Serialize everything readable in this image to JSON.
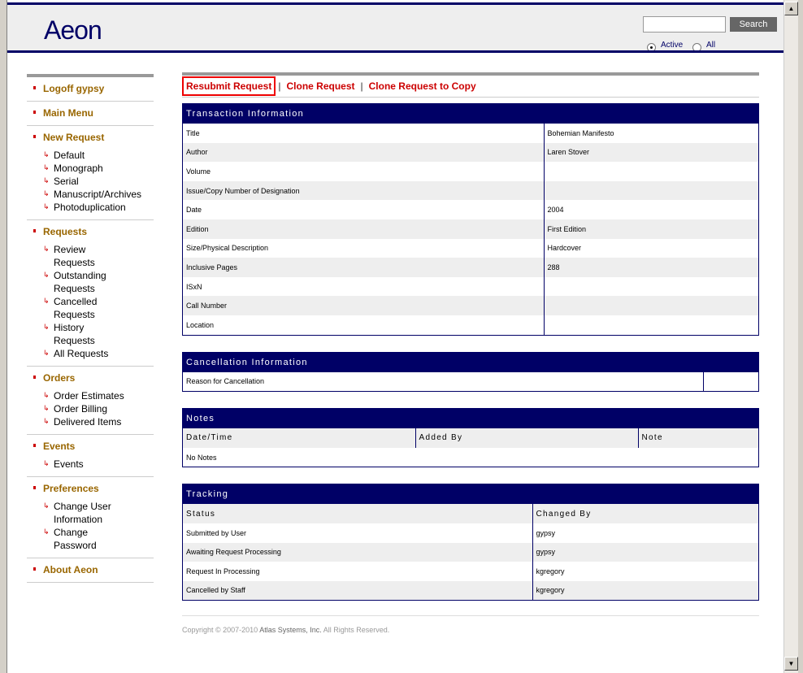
{
  "header": {
    "logo": "Aeon",
    "search_button": "Search",
    "search_value": "",
    "radio_active": "Active",
    "radio_all": "All"
  },
  "sidebar": {
    "sections": [
      {
        "title": "Logoff gypsy",
        "items": []
      },
      {
        "title": "Main Menu",
        "items": []
      },
      {
        "title": "New Request",
        "items": [
          "Default",
          "Monograph",
          "Serial",
          "Manuscript/Archives",
          "Photoduplication"
        ]
      },
      {
        "title": "Requests",
        "items": [
          "Review Requests",
          "Outstanding Requests",
          "Cancelled Requests",
          "History Requests",
          "All Requests"
        ]
      },
      {
        "title": "Orders",
        "items": [
          "Order Estimates",
          "Order Billing",
          "Delivered Items"
        ]
      },
      {
        "title": "Events",
        "items": [
          "Events"
        ]
      },
      {
        "title": "Preferences",
        "items": [
          "Change User Information",
          "Change Password"
        ]
      },
      {
        "title": "About Aeon",
        "items": []
      }
    ]
  },
  "actions": {
    "resubmit": "Resubmit Request",
    "clone": "Clone Request",
    "clone_copy": "Clone Request to Copy",
    "sep": "|"
  },
  "transaction": {
    "title": "Transaction Information",
    "rows": [
      [
        "Title",
        "Bohemian Manifesto"
      ],
      [
        "Author",
        "Laren Stover"
      ],
      [
        "Volume",
        ""
      ],
      [
        "Issue/Copy Number of Designation",
        ""
      ],
      [
        "Date",
        "2004"
      ],
      [
        "Edition",
        "First Edition"
      ],
      [
        "Size/Physical Description",
        "Hardcover"
      ],
      [
        "Inclusive Pages",
        "288"
      ],
      [
        "ISxN",
        ""
      ],
      [
        "Call Number",
        ""
      ],
      [
        "Location",
        ""
      ]
    ]
  },
  "cancellation": {
    "title": "Cancellation Information",
    "label": "Reason for Cancellation",
    "value": ""
  },
  "notes": {
    "title": "Notes",
    "headers": [
      "Date/Time",
      "Added By",
      "Note"
    ],
    "empty": "No Notes"
  },
  "tracking": {
    "title": "Tracking",
    "headers": [
      "Status",
      "Changed By"
    ],
    "rows": [
      [
        "Submitted by User",
        "gypsy"
      ],
      [
        "Awaiting Request Processing",
        "gypsy"
      ],
      [
        "Request In Processing",
        "kgregory"
      ],
      [
        "Cancelled by Staff",
        "kgregory"
      ]
    ]
  },
  "footer": {
    "pre": "Copyright © 2007-2010 ",
    "company": "Atlas Systems, Inc.",
    "post": " All Rights Reserved."
  }
}
